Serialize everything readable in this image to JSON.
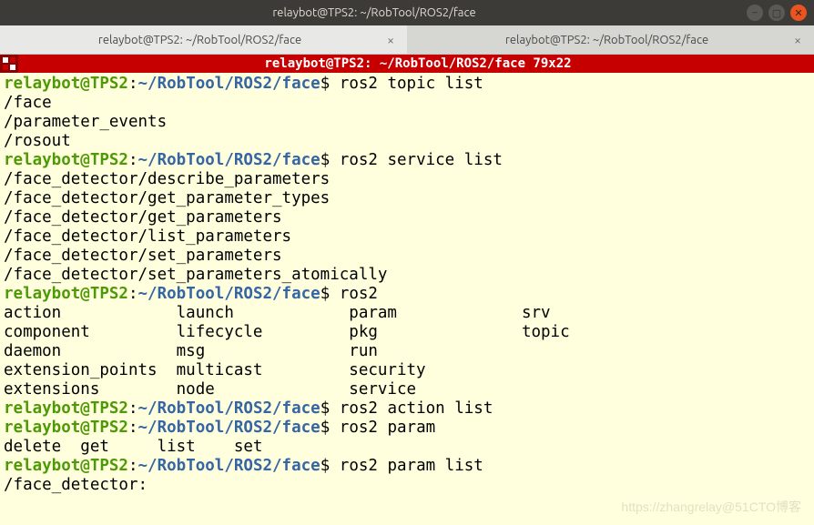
{
  "window": {
    "title": "relaybot@TPS2: ~/RobTool/ROS2/face",
    "min_icon": "–",
    "max_icon": "▢",
    "close_icon": "✕"
  },
  "tabs": [
    {
      "label": "relaybot@TPS2: ~/RobTool/ROS2/face",
      "close": "×"
    },
    {
      "label": "relaybot@TPS2: ~/RobTool/ROS2/face",
      "close": "×"
    }
  ],
  "statusbar": {
    "text": "relaybot@TPS2: ~/RobTool/ROS2/face 79x22"
  },
  "prompt": {
    "user": "relaybot@TPS2",
    "colon": ":",
    "path": "~/RobTool/ROS2/face",
    "dollar": "$ "
  },
  "session": {
    "cmd1": "ros2 topic list",
    "out1": "/face\n/parameter_events\n/rosout",
    "cmd2": "ros2 service list",
    "out2": "/face_detector/describe_parameters\n/face_detector/get_parameter_types\n/face_detector/get_parameters\n/face_detector/list_parameters\n/face_detector/set_parameters\n/face_detector/set_parameters_atomically",
    "cmd3": "ros2 ",
    "out3": "action            launch            param             srv               \ncomponent         lifecycle         pkg               topic             \ndaemon            msg               run               \nextension_points  multicast         security          \nextensions        node              service           ",
    "cmd4": "ros2 action list",
    "cmd5": "ros2 param ",
    "out5": "delete  get     list    set     ",
    "cmd6": "ros2 param list",
    "out6": "/face_detector:"
  },
  "watermark": "https://zhangrelay@51CTO博客"
}
